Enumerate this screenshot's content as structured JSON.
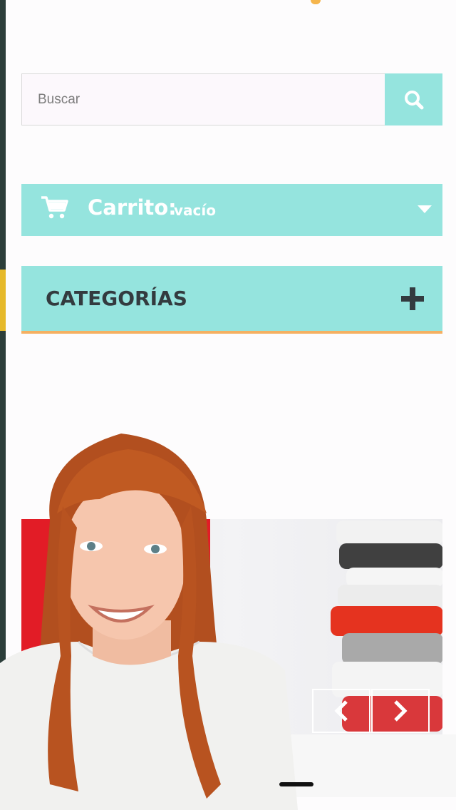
{
  "search": {
    "placeholder": "Buscar",
    "button_icon": "search-icon"
  },
  "cart": {
    "title": "Carrito:",
    "status": "vacío",
    "icon": "cart-icon"
  },
  "categories": {
    "title": "CATEGORÍAS",
    "toggle_icon": "plus-icon"
  },
  "slider": {
    "prev_icon": "chevron-left-icon",
    "next_icon": "chevron-right-icon"
  },
  "colors": {
    "accent": "#95e4de",
    "accent_border": "#f5b062",
    "heading": "#333b3f",
    "banner_red": "#e21c26"
  }
}
